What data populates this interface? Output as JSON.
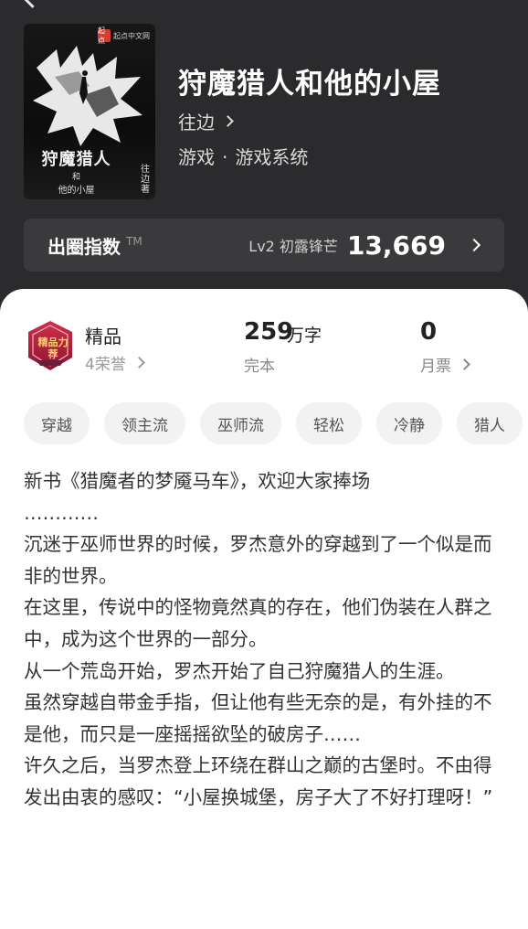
{
  "book": {
    "title": "狩魔猎人和他的小屋",
    "author": "往边",
    "genre": "游戏",
    "subgenre": "游戏系统",
    "genre_separator": "·"
  },
  "cover": {
    "publisher_mark": "起点",
    "publisher": "起点中文网",
    "title": "狩魔猎人",
    "subtitle_and": "和",
    "subtitle": "他的小屋",
    "author_credit": "往边著"
  },
  "index": {
    "label": "出圈指数",
    "trademark": "TM",
    "level": "Lv2 初露锋芒",
    "value": "13,669"
  },
  "stats": {
    "quality": "精品",
    "badge_text": "精品力荐",
    "honors": "4荣誉",
    "word_count": "259",
    "word_unit": "万字",
    "status": "完本",
    "monthly_tickets": "0",
    "monthly_tickets_label": "月票"
  },
  "tags": [
    "穿越",
    "领主流",
    "巫师流",
    "轻松",
    "冷静",
    "猎人"
  ],
  "description": [
    "新书《猎魔者的梦魇马车》，欢迎大家捧场",
    "…………",
    "沉迷于巫师世界的时候，罗杰意外的穿越到了一个似是而非的世界。",
    "在这里，传说中的怪物竟然真的存在，他们伪装在人群之中，成为这个世界的一部分。",
    "从一个荒岛开始，罗杰开始了自己狩魔猎人的生涯。",
    "虽然穿越自带金手指，但让他有些无奈的是，有外挂的不是他，而只是一座摇摇欲坠的破房子……",
    "许久之后，当罗杰登上环绕在群山之巅的古堡时。不由得发出由衷的感叹：“小屋换城堡，房子大了不好打理呀！”"
  ],
  "colors": {
    "header_bg": "#2b2b2d",
    "index_bar_bg": "#3a3a3c",
    "tag_bg": "#f2f2f2",
    "badge_red": "#b8223a",
    "publisher_red": "#d83b2f"
  },
  "icons": {
    "back": "back-arrow-icon",
    "chevron": "chevron-right-icon",
    "badge": "quality-badge-icon"
  }
}
